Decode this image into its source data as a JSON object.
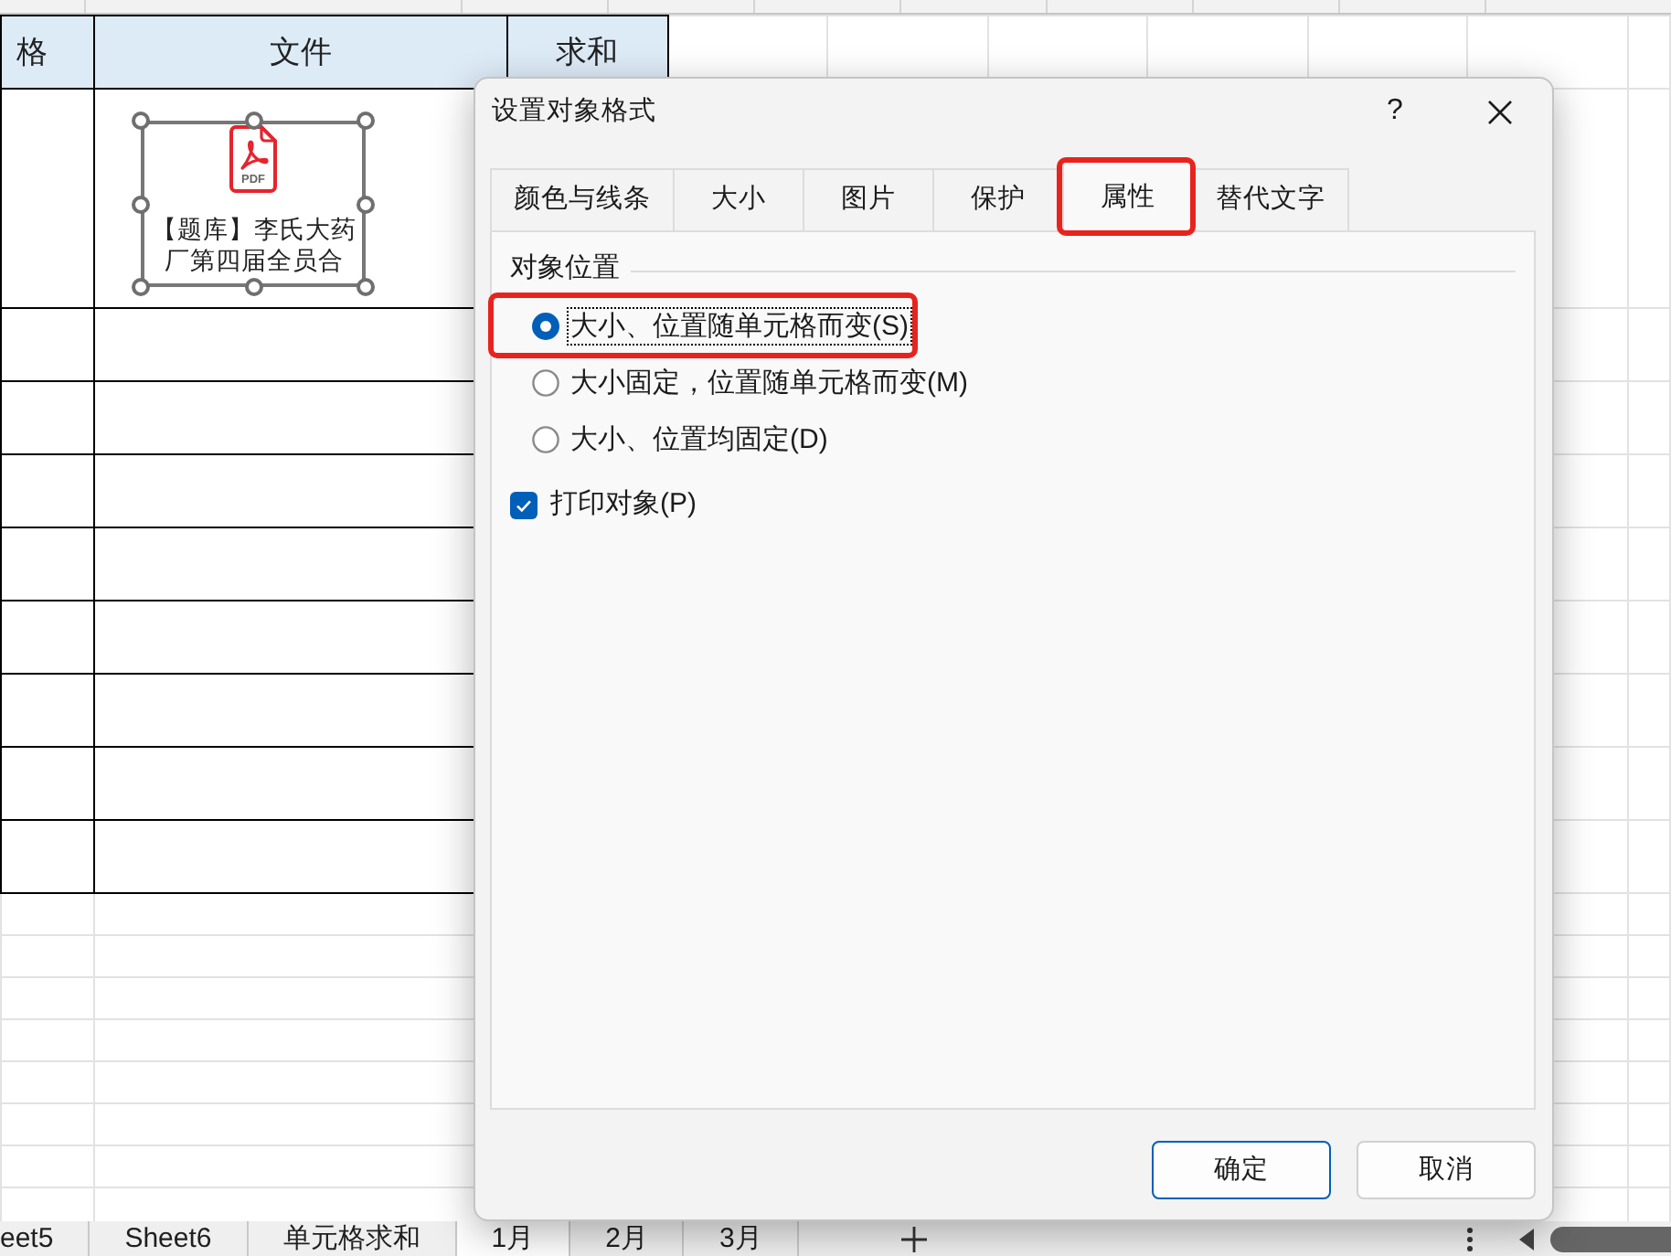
{
  "sheet": {
    "table": {
      "columns": [
        "格",
        "文件",
        "求和"
      ]
    },
    "embedded_object": {
      "icon_text": "PDF",
      "label": "【题库】李氏大药厂第四届全员合",
      "selected": true
    },
    "sheet_tabs": [
      {
        "label": "eet5",
        "selected": false
      },
      {
        "label": "Sheet6",
        "selected": false
      },
      {
        "label": "单元格求和",
        "selected": false
      },
      {
        "label": "1月",
        "selected": true
      },
      {
        "label": "2月",
        "selected": false
      },
      {
        "label": "3月",
        "selected": false
      }
    ]
  },
  "dialog": {
    "title": "设置对象格式",
    "help_label": "?",
    "tabs": [
      {
        "label": "颜色与线条",
        "selected": false,
        "highlighted": false
      },
      {
        "label": "大小",
        "selected": false,
        "highlighted": false
      },
      {
        "label": "图片",
        "selected": false,
        "highlighted": false
      },
      {
        "label": "保护",
        "selected": false,
        "highlighted": false
      },
      {
        "label": "属性",
        "selected": true,
        "highlighted": true
      },
      {
        "label": "替代文字",
        "selected": false,
        "highlighted": false
      }
    ],
    "group": {
      "title": "对象位置",
      "options": [
        {
          "label": "大小、位置随单元格而变(S)",
          "selected": true,
          "focused": true,
          "highlighted": true
        },
        {
          "label": "大小固定，位置随单元格而变(M)",
          "selected": false,
          "focused": false,
          "highlighted": false
        },
        {
          "label": "大小、位置均固定(D)",
          "selected": false,
          "focused": false,
          "highlighted": false
        }
      ]
    },
    "checkboxes": [
      {
        "label": "打印对象(P)",
        "checked": true
      }
    ],
    "buttons": [
      {
        "label": "确定",
        "default": true
      },
      {
        "label": "取消",
        "default": false
      }
    ]
  }
}
